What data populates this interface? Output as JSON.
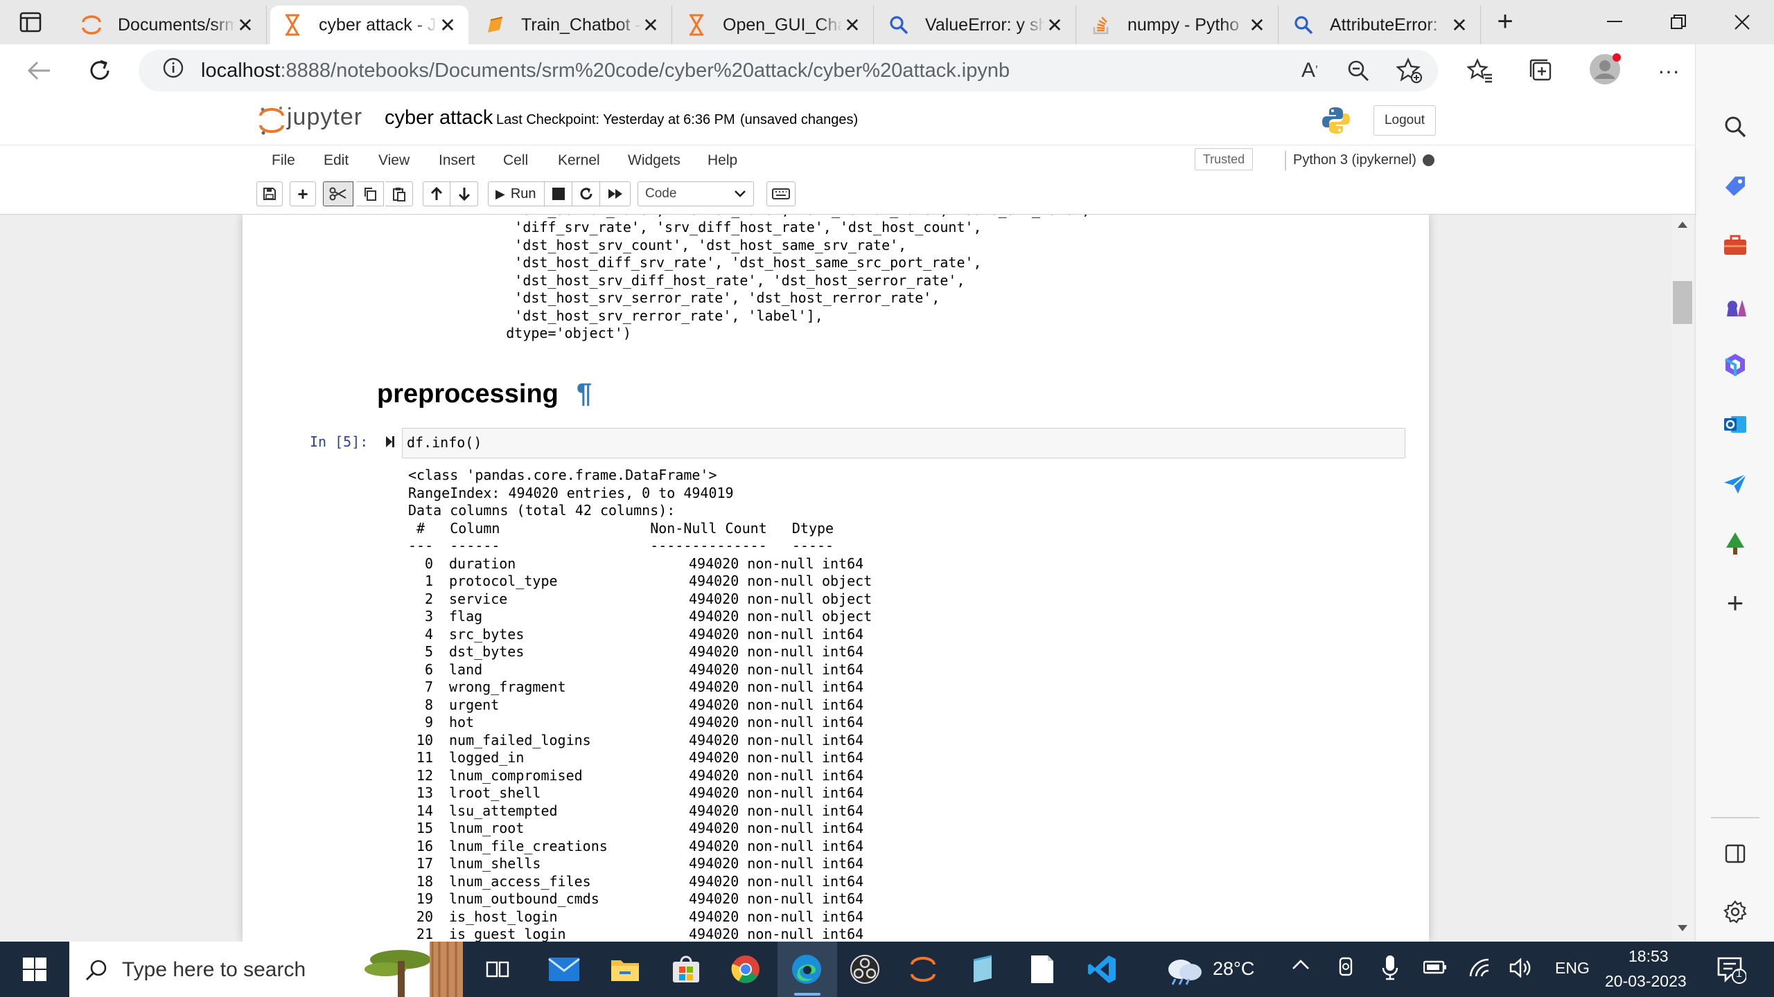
{
  "browser": {
    "tabs": [
      {
        "title": "Documents/srm",
        "icon": "jupyter-logo-icon"
      },
      {
        "title": "cyber attack - J",
        "icon": "hourglass-icon",
        "active": true
      },
      {
        "title": "Train_Chatbot -",
        "icon": "document-edit-icon"
      },
      {
        "title": "Open_GUI_Cha",
        "icon": "hourglass-icon"
      },
      {
        "title": "ValueError: y sh",
        "icon": "search-icon"
      },
      {
        "title": "numpy - Pytho",
        "icon": "stackoverflow-icon"
      },
      {
        "title": "AttributeError:",
        "icon": "search-icon"
      }
    ],
    "url_host": "localhost",
    "url_path": ":8888/notebooks/Documents/srm%20code/cyber%20attack/cyber%20attack.ipynb"
  },
  "jupyter": {
    "logo_text": "jupyter",
    "notebook_name": "cyber attack",
    "checkpoint": "Last Checkpoint: Yesterday at 6:36 PM",
    "unsaved": "(unsaved changes)",
    "logout": "Logout",
    "menus": [
      "File",
      "Edit",
      "View",
      "Insert",
      "Cell",
      "Kernel",
      "Widgets",
      "Help"
    ],
    "trusted": "Trusted",
    "kernel": "Python 3 (ipykernel)",
    "run_label": "Run",
    "cell_type": "Code"
  },
  "notebook": {
    "prev_output_lines": [
      "       'diff_srv_rate', 'srv_diff_host_rate', 'dst_host_count',",
      "       'dst_host_srv_count', 'dst_host_same_srv_rate',",
      "       'dst_host_diff_srv_rate', 'dst_host_same_src_port_rate',",
      "       'dst_host_srv_diff_host_rate', 'dst_host_serror_rate',",
      "       'dst_host_srv_serror_rate', 'dst_host_rerror_rate',",
      "       'dst_host_srv_rerror_rate', 'label'],",
      "      dtype='object')"
    ],
    "heading": "preprocessing",
    "pilcrow": "¶",
    "prompt": "In [5]:",
    "code": "df.info()",
    "info_header": [
      "<class 'pandas.core.frame.DataFrame'>",
      "RangeIndex: 494020 entries, 0 to 494019",
      "Data columns (total 42 columns):",
      " #   Column                  Non-Null Count   Dtype ",
      "---  ------                  --------------   ----- "
    ],
    "info_rows": [
      {
        "idx": "0",
        "col": "duration",
        "count": "494020 non-null",
        "dtype": "int64"
      },
      {
        "idx": "1",
        "col": "protocol_type",
        "count": "494020 non-null",
        "dtype": "object"
      },
      {
        "idx": "2",
        "col": "service",
        "count": "494020 non-null",
        "dtype": "object"
      },
      {
        "idx": "3",
        "col": "flag",
        "count": "494020 non-null",
        "dtype": "object"
      },
      {
        "idx": "4",
        "col": "src_bytes",
        "count": "494020 non-null",
        "dtype": "int64"
      },
      {
        "idx": "5",
        "col": "dst_bytes",
        "count": "494020 non-null",
        "dtype": "int64"
      },
      {
        "idx": "6",
        "col": "land",
        "count": "494020 non-null",
        "dtype": "int64"
      },
      {
        "idx": "7",
        "col": "wrong_fragment",
        "count": "494020 non-null",
        "dtype": "int64"
      },
      {
        "idx": "8",
        "col": "urgent",
        "count": "494020 non-null",
        "dtype": "int64"
      },
      {
        "idx": "9",
        "col": "hot",
        "count": "494020 non-null",
        "dtype": "int64"
      },
      {
        "idx": "10",
        "col": "num_failed_logins",
        "count": "494020 non-null",
        "dtype": "int64"
      },
      {
        "idx": "11",
        "col": "logged_in",
        "count": "494020 non-null",
        "dtype": "int64"
      },
      {
        "idx": "12",
        "col": "lnum_compromised",
        "count": "494020 non-null",
        "dtype": "int64"
      },
      {
        "idx": "13",
        "col": "lroot_shell",
        "count": "494020 non-null",
        "dtype": "int64"
      },
      {
        "idx": "14",
        "col": "lsu_attempted",
        "count": "494020 non-null",
        "dtype": "int64"
      },
      {
        "idx": "15",
        "col": "lnum_root",
        "count": "494020 non-null",
        "dtype": "int64"
      },
      {
        "idx": "16",
        "col": "lnum_file_creations",
        "count": "494020 non-null",
        "dtype": "int64"
      },
      {
        "idx": "17",
        "col": "lnum_shells",
        "count": "494020 non-null",
        "dtype": "int64"
      },
      {
        "idx": "18",
        "col": "lnum_access_files",
        "count": "494020 non-null",
        "dtype": "int64"
      },
      {
        "idx": "19",
        "col": "lnum_outbound_cmds",
        "count": "494020 non-null",
        "dtype": "int64"
      },
      {
        "idx": "20",
        "col": "is_host_login",
        "count": "494020 non-null",
        "dtype": "int64"
      },
      {
        "idx": "21",
        "col": "is_guest_login",
        "count": "494020 non-null",
        "dtype": "int64"
      }
    ]
  },
  "taskbar": {
    "search_placeholder": "Type here to search",
    "weather": "28°C",
    "language": "ENG",
    "time": "18:53",
    "date": "20-03-2023",
    "notification_count": "1"
  }
}
